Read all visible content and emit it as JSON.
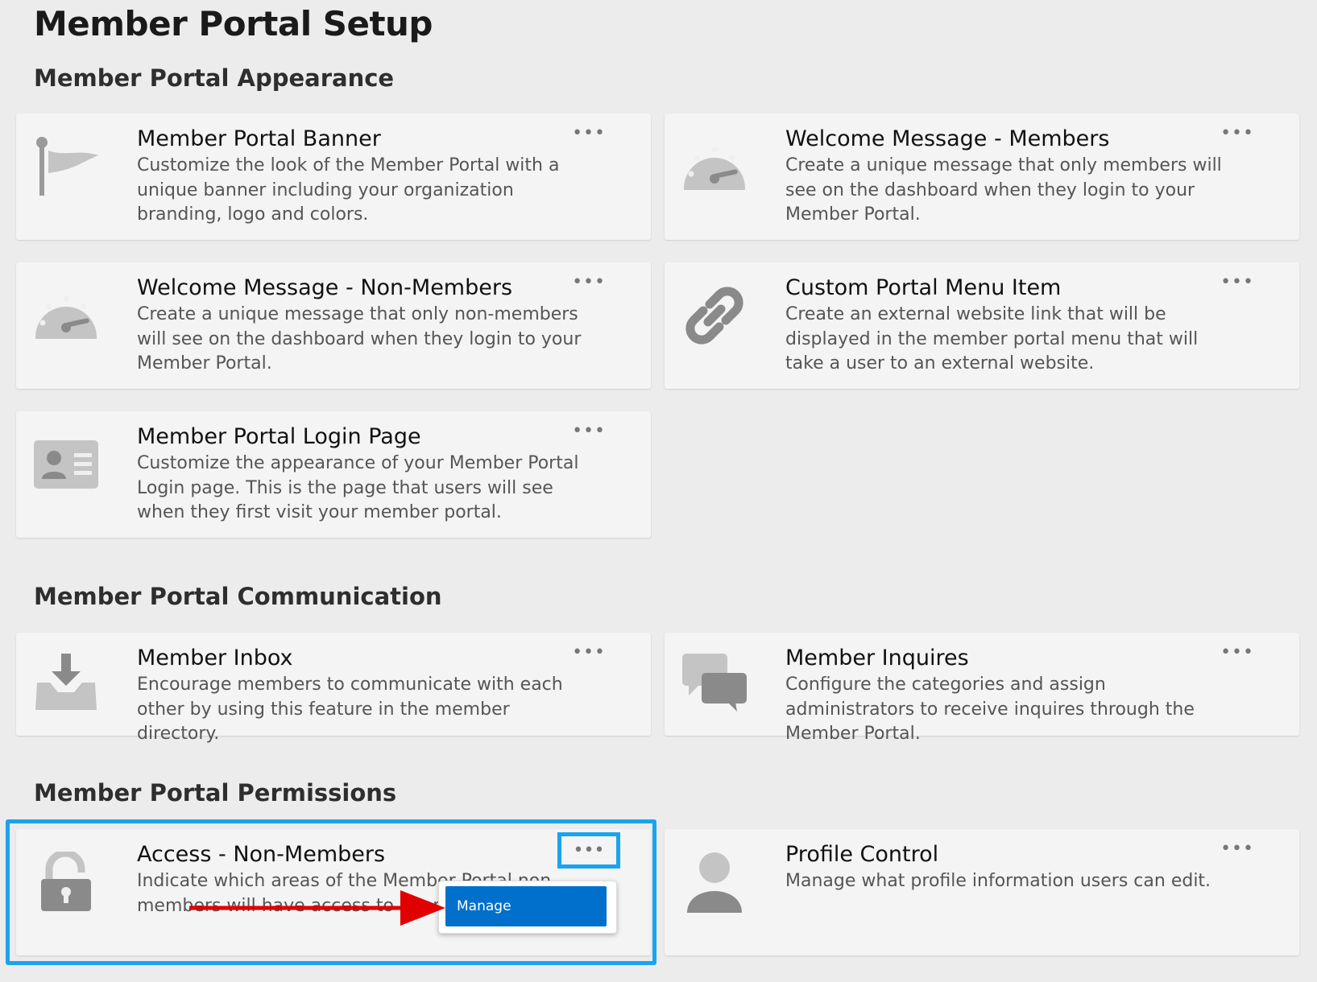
{
  "page_title": "Member Portal Setup",
  "more_label": "•••",
  "sections": {
    "appearance": {
      "title": "Member Portal Appearance",
      "cards": [
        {
          "title": "Member Portal Banner",
          "desc": "Customize the look of the Member Portal with a unique banner including your organization branding, logo and colors.",
          "icon": "flag-icon"
        },
        {
          "title": "Welcome Message - Members",
          "desc": "Create a unique message that only members will see on the dashboard when they login to your Member Portal.",
          "icon": "gauge-icon"
        },
        {
          "title": "Welcome Message - Non-Members",
          "desc": "Create a unique message that only non-members will see on the dashboard when they login to your Member Portal.",
          "icon": "gauge-icon"
        },
        {
          "title": "Custom Portal Menu Item",
          "desc": "Create an external website link that will be displayed in the member portal menu that will take a user to an external website.",
          "icon": "link-icon"
        },
        {
          "title": "Member Portal Login Page",
          "desc": "Customize the appearance of your Member Portal Login page. This is the page that users will see when they first visit your member portal.",
          "icon": "id-card-icon"
        }
      ]
    },
    "communication": {
      "title": "Member Portal Communication",
      "cards": [
        {
          "title": "Member Inbox",
          "desc": "Encourage members to communicate with each other by using this feature in the member directory.",
          "icon": "inbox-download-icon"
        },
        {
          "title": "Member Inquires",
          "desc": "Configure the categories and assign administrators to receive inquires through the Member Portal.",
          "icon": "chat-bubbles-icon"
        }
      ]
    },
    "permissions": {
      "title": "Member Portal Permissions",
      "cards": [
        {
          "title": "Access - Non-Members",
          "desc": "Indicate which areas of the Member Portal non-members will have access to upon",
          "icon": "unlocked-icon"
        },
        {
          "title": "Profile Control",
          "desc": "Manage what profile information users can edit.",
          "icon": "user-icon"
        }
      ]
    }
  },
  "context_menu": {
    "manage_label": "Manage"
  },
  "colors": {
    "background": "#ececec",
    "card": "#f4f4f4",
    "highlight": "#1aa3ef",
    "menu_item": "#0070cc",
    "arrow": "#e00000",
    "icon": "#b8b8b8"
  }
}
